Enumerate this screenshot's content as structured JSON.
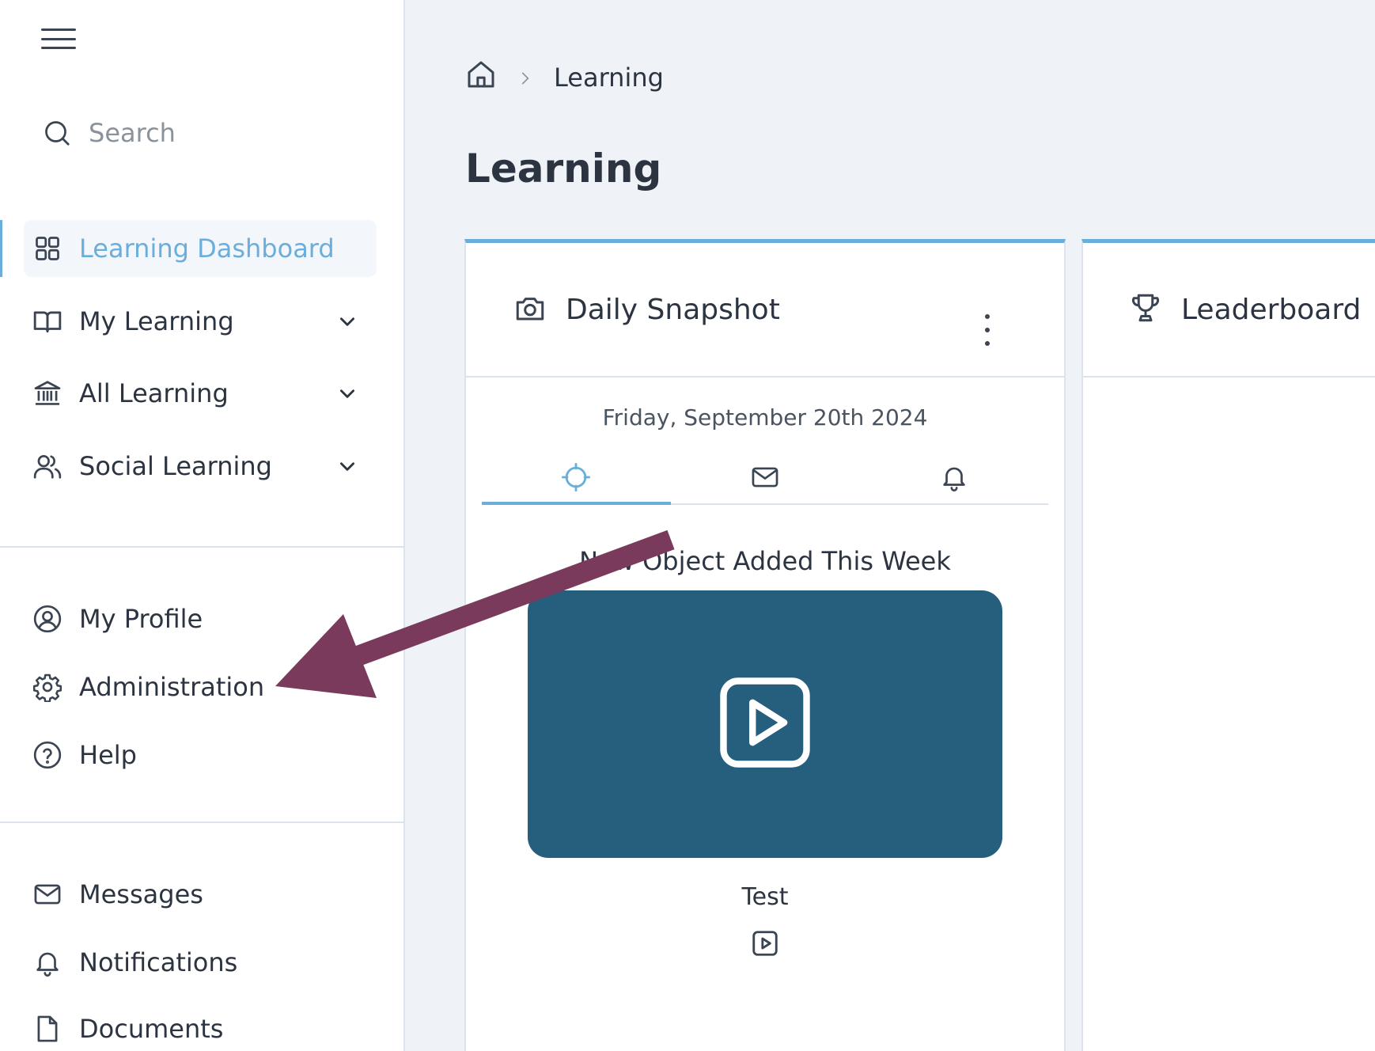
{
  "sidebar": {
    "search_placeholder": "Search",
    "primary": [
      {
        "label": "Learning Dashboard",
        "icon": "grid-icon",
        "active": true
      },
      {
        "label": "My Learning",
        "icon": "book-icon",
        "expandable": true
      },
      {
        "label": "All Learning",
        "icon": "library-icon",
        "expandable": true
      },
      {
        "label": "Social Learning",
        "icon": "users-icon",
        "expandable": true
      }
    ],
    "account": [
      {
        "label": "My Profile",
        "icon": "user-circle-icon"
      },
      {
        "label": "Administration",
        "icon": "gear-icon"
      },
      {
        "label": "Help",
        "icon": "question-circle-icon"
      }
    ],
    "utility": [
      {
        "label": "Messages",
        "icon": "mail-icon"
      },
      {
        "label": "Notifications",
        "icon": "bell-icon"
      },
      {
        "label": "Documents",
        "icon": "document-icon"
      }
    ]
  },
  "breadcrumb": {
    "current": "Learning"
  },
  "page": {
    "title": "Learning"
  },
  "cards": {
    "daily_snapshot": {
      "title": "Daily Snapshot",
      "date": "Friday, September 20th 2024",
      "tabs": [
        "target-icon",
        "mail-icon",
        "bell-icon"
      ],
      "active_tab": 0,
      "section_title": "New Object Added This Week",
      "item_title": "Test",
      "item_type_icon": "video-icon"
    },
    "leaderboard": {
      "title": "Leaderboard"
    }
  },
  "colors": {
    "accent": "#6aaedb",
    "video_tile": "#265e7d",
    "annotation_arrow": "#7a3a5c"
  }
}
